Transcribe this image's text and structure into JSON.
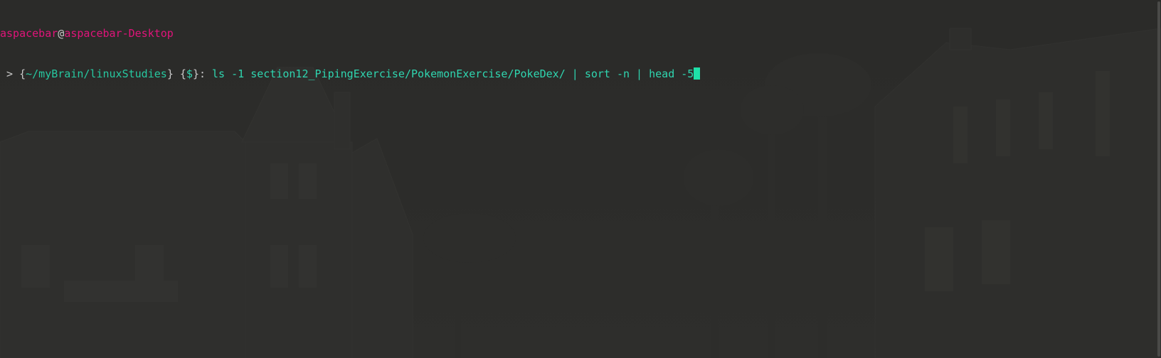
{
  "prompt": {
    "user": "aspacebar",
    "at": "@",
    "host": "aspacebar-Desktop",
    "gt": " > ",
    "cwd_open": "{",
    "cwd": "~/myBrain/linuxStudies",
    "cwd_close": "}",
    "sym_open": " {",
    "sym": "$",
    "sym_close": "}: "
  },
  "command": "ls -1 section12_PipingExercise/PokemonExercise/PokeDex/ | sort -n | head -5",
  "colors": {
    "background": "#2d2d2b",
    "user": "#e0147a",
    "path": "#26c8a0",
    "command": "#2fd6b0",
    "cursor": "#1fe0a8"
  }
}
